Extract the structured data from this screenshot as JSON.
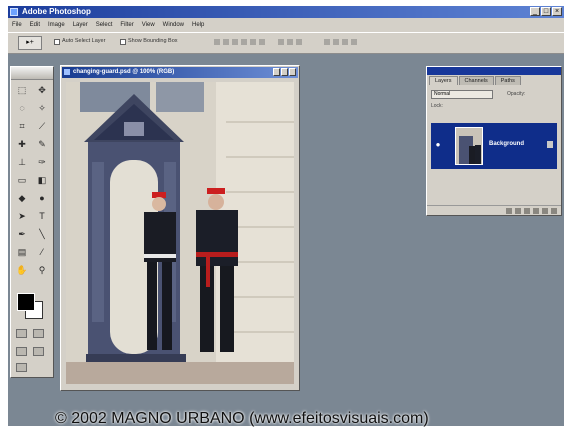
{
  "app": {
    "title": "Adobe Photoshop",
    "window_buttons": [
      "_",
      "□",
      "×"
    ]
  },
  "menu": [
    "File",
    "Edit",
    "Image",
    "Layer",
    "Select",
    "Filter",
    "View",
    "Window",
    "Help"
  ],
  "options": {
    "tool": "▸+",
    "auto_select_label": "Auto Select Layer",
    "bounding_box_label": "Show Bounding Box"
  },
  "document": {
    "title": "changing-guard.psd @ 100% (RGB)"
  },
  "layers_panel": {
    "tabs": [
      "Layers",
      "Channels",
      "Paths"
    ],
    "blend_mode": "Normal",
    "opacity_label": "Opacity:",
    "lock_label": "Lock:",
    "layer_name": "Background"
  },
  "colors": {
    "foreground": "#000000",
    "background": "#ffffff",
    "workspace": "#7b8793",
    "titlebar": "#1d3e9d"
  },
  "watermark": "© 2002 MAGNO URBANO (www.efeitosvisuais.com)"
}
